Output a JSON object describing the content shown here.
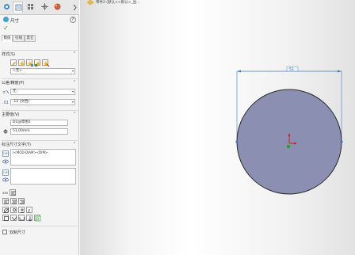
{
  "property_manager": {
    "title": "尺寸",
    "help": "?",
    "tabs": [
      "数值",
      "引线",
      "其它"
    ]
  },
  "sections": {
    "style": {
      "header": "样式(S)",
      "dropdown": "<无>"
    },
    "tolerance": {
      "header": "公差/精度(P)",
      "tolerance_type": "无",
      "precision": ".12 (文档)"
    },
    "primary_value": {
      "header": "主要值(V)",
      "name": "D1@草图1",
      "value": "51.00mm"
    },
    "dim_text": {
      "header": "标注尺寸文字(T)",
      "text": "(<MOD-DIAM><DIM>"
    },
    "dual_dimension": {
      "label": "双制尺寸"
    }
  },
  "breadcrumb": {
    "text": "零件2 (默认<<默认>_显..."
  },
  "sketch": {
    "dimension_label": "51",
    "circle_fill": "#8b8fb2",
    "dimension_color": "#3a7ac8"
  }
}
